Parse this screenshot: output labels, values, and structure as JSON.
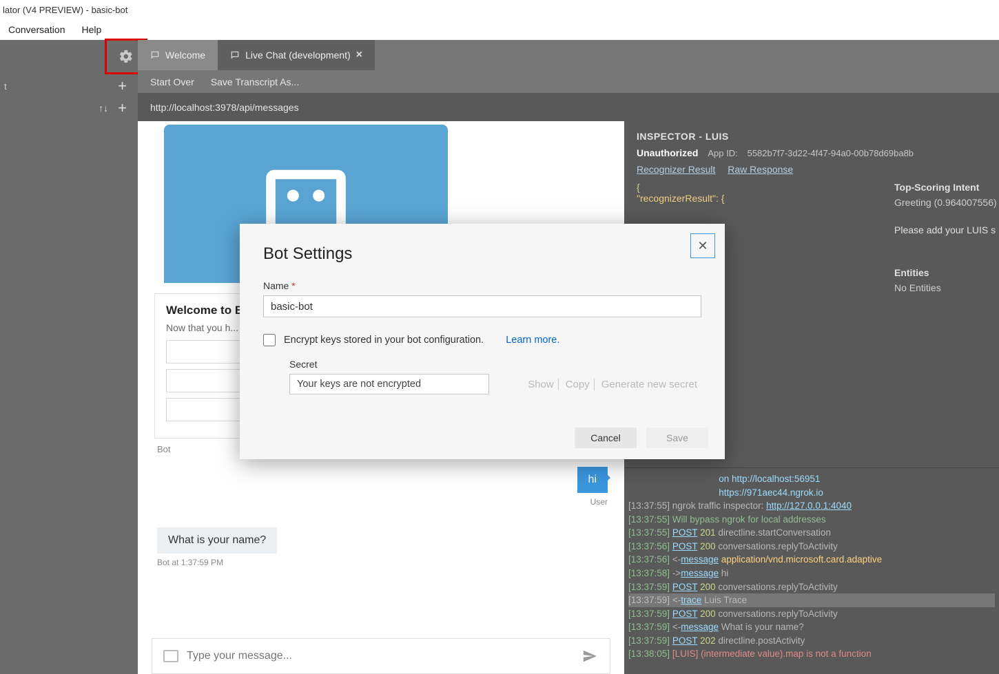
{
  "window": {
    "title": "lator (V4 PREVIEW) - basic-bot"
  },
  "menu": {
    "conversation": "Conversation",
    "help": "Help"
  },
  "sidebar": {
    "item0": "t"
  },
  "tabs": {
    "welcome": "Welcome",
    "livechat": "Live Chat (development)"
  },
  "subbar": {
    "startover": "Start Over",
    "savetranscript": "Save Transcript As..."
  },
  "urlbar": {
    "url": "http://localhost:3978/api/messages"
  },
  "welcome_card": {
    "title": "Welcome to B",
    "body": "Now that you h... Adaptive Card..."
  },
  "chat": {
    "bot_label": "Bot",
    "hi": "hi",
    "user_label": "User",
    "botq": "What is your name?",
    "bottime": "Bot at 1:37:59 PM",
    "placeholder": "Type your message..."
  },
  "inspector": {
    "title": "INSPECTOR - LUIS",
    "status": "Unauthorized",
    "appid_label": "App ID:",
    "appid": "5582b7f7-3d22-4f47-94a0-00b78d69ba8b",
    "link_recognizer": "Recognizer Result",
    "link_raw": "Raw Response",
    "json_l1": "{",
    "json_l2": "  \"recognizerResult\": {",
    "intent_h": "Top-Scoring Intent",
    "intent_v": "Greeting (0.964007556)",
    "luis_prompt": "Please add your LUIS s",
    "entities_h": "Entities",
    "entities_v": "No Entities"
  },
  "log": {
    "l0a": " on http://localhost:56951",
    "l0b": " https://971aec44.ngrok.io",
    "l0c": "[13:37:55] ngrok traffic inspector: ",
    "l0c_url": "http://127.0.0.1:4040",
    "l1": "[13:37:55] Will bypass ngrok for local addresses",
    "l2_ts": "[13:37:55] ",
    "l2_post": "POST",
    "l2_code": "201",
    "l2_rest": " directline.startConversation",
    "l3_ts": "[13:37:56] ",
    "l3_post": "POST",
    "l3_code": "200",
    "l3_rest": " conversations.replyToActivity",
    "l4_ts": "[13:37:56] ",
    "l4_arrow": "<-",
    "l4_msg": "message",
    "l4_rest": " application/vnd.microsoft.card.adaptive",
    "l5_ts": "[13:37:58] ",
    "l5_arrow": "->",
    "l5_msg": "message",
    "l5_rest": " hi",
    "l6_ts": "[13:37:59] ",
    "l6_post": "POST",
    "l6_code": "200",
    "l6_rest": " conversations.replyToActivity",
    "l7_ts": "[13:37:59] ",
    "l7_arrow": "<-",
    "l7_msg": "trace",
    "l7_rest": " Luis Trace",
    "l8_ts": "[13:37:59] ",
    "l8_post": "POST",
    "l8_code": "200",
    "l8_rest": " conversations.replyToActivity",
    "l9_ts": "[13:37:59] ",
    "l9_arrow": "<-",
    "l9_msg": "message",
    "l9_rest": " What is your name?",
    "l10_ts": "[13:37:59] ",
    "l10_post": "POST",
    "l10_code": "202",
    "l10_rest": " directline.postActivity",
    "l11_ts": "[13:38:05] ",
    "l11_rest": "[LUIS] (intermediate value).map is not a function"
  },
  "modal": {
    "title": "Bot Settings",
    "name_label": "Name",
    "name_value": "basic-bot",
    "encrypt_label": "Encrypt keys stored in your bot configuration.",
    "learn_more": "Learn more.",
    "secret_label": "Secret",
    "secret_placeholder": "Your keys are not encrypted",
    "show": "Show",
    "copy": "Copy",
    "gen": "Generate new secret",
    "cancel": "Cancel",
    "save": "Save"
  }
}
